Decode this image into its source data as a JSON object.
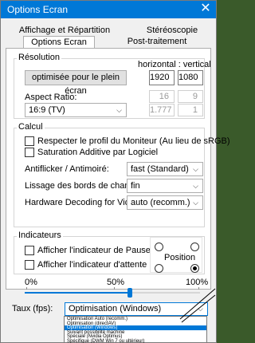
{
  "window": {
    "title": "Options Ecran",
    "close": "✕"
  },
  "tabs": {
    "back": [
      "Affichage et Répartition Ecran:",
      "Stéréoscopie"
    ],
    "front": [
      "Options Ecran",
      "Post-traitement Images"
    ]
  },
  "resolution": {
    "group_label": "Résolution",
    "header": "horizontal : vertical",
    "button_label": "optimisée pour le plein écran",
    "width": "1920",
    "height": "1080",
    "aspect_label": "Aspect Ratio:",
    "aspect_select": "16:9 (TV)",
    "aspect_w": "16",
    "aspect_h": "9",
    "aspect_ratio": "1.777",
    "aspect_one": "1"
  },
  "calcul": {
    "group_label": "Calcul",
    "check1": "Respecter le profil du Moniteur (Au lieu de sRGB)",
    "check2": "Saturation Additive par Logiciel",
    "antiflicker_label": "Antiflicker / Antimoiré:",
    "antiflicker_value": "fast (Standard)",
    "lissage_label": "Lissage des bords de champs:",
    "lissage_value": "fin",
    "hwdecode_label": "Hardware Decoding for Video:",
    "hwdecode_value": "auto (recomm.)"
  },
  "indicateurs": {
    "group_label": "Indicateurs",
    "check_pause": "Afficher l'indicateur de Pause",
    "check_attente": "Afficher l'indicateur d'attente",
    "position_label": "Position",
    "slider_min": "0%",
    "slider_mid": "50%",
    "slider_max": "100%",
    "slider_value": 0.6
  },
  "taux": {
    "label": "Taux (fps):",
    "selected": "Optimisation (Windows)",
    "options": [
      "Optimisation Auto (recomm.)",
      "Optimisation (directAV)",
      "Optimisation (Windows)",
      "Suivant possibilité machine",
      "Spéciale (Nvidia Optimus)",
      "Spécifique (DWM Win 7 ou ultérieur)"
    ],
    "highlighted_index": 2
  },
  "icons": {
    "chevron": "chevron-down-icon",
    "close": "close-icon"
  },
  "colors": {
    "accent": "#0078d7",
    "titlebar": "#0078d7"
  }
}
